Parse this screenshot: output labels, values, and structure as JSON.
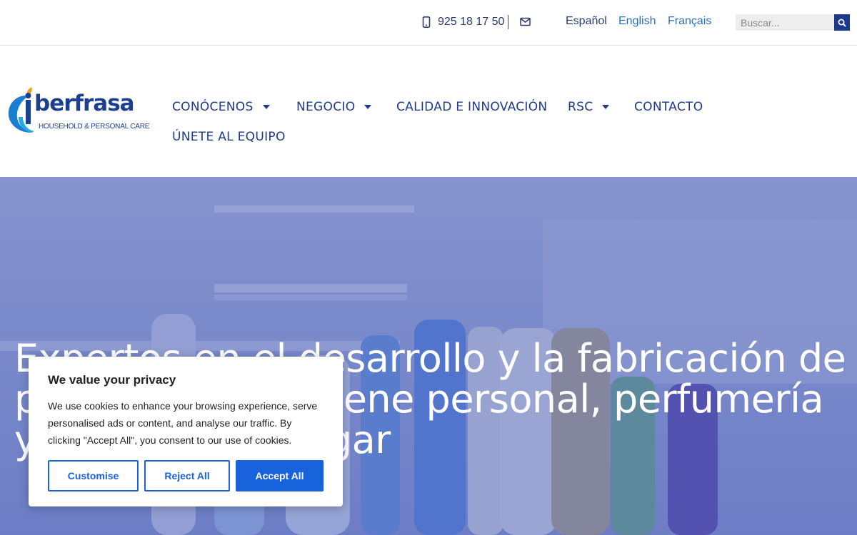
{
  "topbar": {
    "phone": "925 18 17 50",
    "phone_icon": "mobile-phone-icon",
    "mail_icon": "envelope-icon",
    "languages": [
      "Español",
      "English",
      "Français"
    ],
    "search_placeholder": "Buscar...",
    "search_icon": "search-icon"
  },
  "header": {
    "logo_text": "berfrasa",
    "logo_subtitle": "HOUSEHOLD & PERSONAL CARE",
    "nav": [
      {
        "label": "CONÓCENOS",
        "has_dropdown": true
      },
      {
        "label": "NEGOCIO",
        "has_dropdown": true
      },
      {
        "label": "CALIDAD E INNOVACIÓN",
        "has_dropdown": false
      },
      {
        "label": "RSC",
        "has_dropdown": true
      },
      {
        "label": "CONTACTO",
        "has_dropdown": false
      },
      {
        "label": "ÚNETE AL EQUIPO",
        "has_dropdown": false
      }
    ]
  },
  "hero": {
    "title": "Expertos en el desarrollo y la fabricación de productos de higiene personal, perfumería y cuidado del hogar"
  },
  "cookie": {
    "title": "We value your privacy",
    "text": "We use cookies to enhance your browsing experience, serve personalised ads or content, and analyse our traffic. By clicking \"Accept All\", you consent to our use of cookies.",
    "customise": "Customise",
    "reject": "Reject All",
    "accept": "Accept All"
  },
  "colors": {
    "brand_blue": "#1e3a8a",
    "link_blue": "#2c6fb5",
    "cookie_button": "#1863dc",
    "hero_overlay": "#465cb4"
  }
}
